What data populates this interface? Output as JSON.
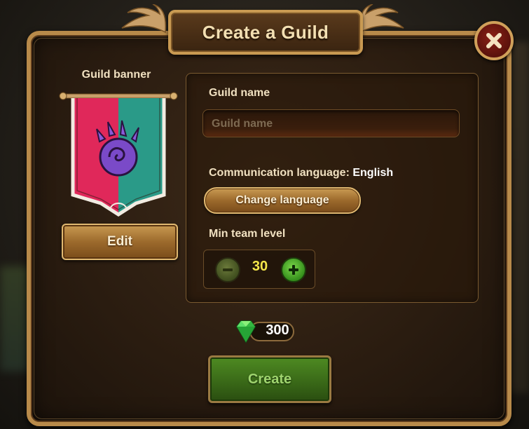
{
  "dialog": {
    "title": "Create a Guild"
  },
  "banner_section": {
    "label": "Guild banner",
    "edit_label": "Edit",
    "banner_colors": {
      "left": "#e0285a",
      "right": "#2a9a88"
    },
    "emblem_icon": "paw-emblem-icon"
  },
  "form": {
    "guild_name_label": "Guild name",
    "guild_name_placeholder": "Guild name",
    "guild_name_value": "",
    "language_label": "Communication language:",
    "language_value": "English",
    "change_language_label": "Change language",
    "min_level_label": "Min team level",
    "min_level_value": "30"
  },
  "cost": {
    "icon": "emerald-gem-icon",
    "value": "300"
  },
  "actions": {
    "create_label": "Create",
    "close_icon": "close-icon"
  },
  "colors": {
    "frame_gold": "#c99a52",
    "panel_brown": "#2a1c10",
    "create_green": "#3a6a18",
    "level_yellow": "#f4e64a"
  }
}
